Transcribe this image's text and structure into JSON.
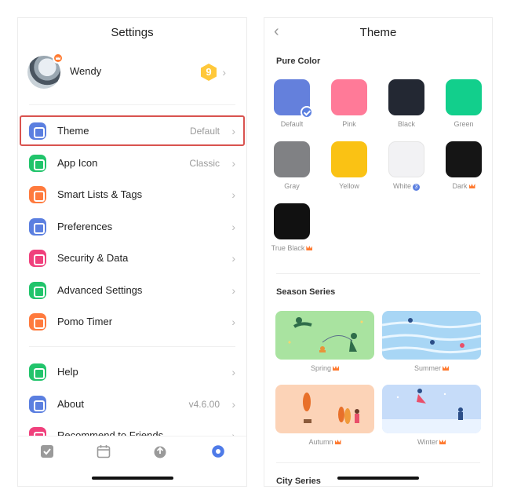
{
  "settings": {
    "title": "Settings",
    "profile": {
      "name": "Wendy",
      "level": "9"
    },
    "menu": [
      {
        "label": "Theme",
        "value": "Default",
        "icon": "theme-icon",
        "color": "#5b7fe0"
      },
      {
        "label": "App Icon",
        "value": "Classic",
        "icon": "app-icon-icon",
        "color": "#21c46b"
      },
      {
        "label": "Smart Lists & Tags",
        "value": "",
        "icon": "smart-lists-icon",
        "color": "#ff7a3d"
      },
      {
        "label": "Preferences",
        "value": "",
        "icon": "preferences-icon",
        "color": "#5b7fe0"
      },
      {
        "label": "Security & Data",
        "value": "",
        "icon": "lock-icon",
        "color": "#f0407c"
      },
      {
        "label": "Advanced Settings",
        "value": "",
        "icon": "sliders-icon",
        "color": "#21c46b"
      },
      {
        "label": "Pomo Timer",
        "value": "",
        "icon": "pomo-timer-icon",
        "color": "#ff7a3d"
      }
    ],
    "menu2": [
      {
        "label": "Help",
        "value": "",
        "icon": "help-icon",
        "color": "#21c46b"
      },
      {
        "label": "About",
        "value": "v4.6.00",
        "icon": "info-icon",
        "color": "#5b7fe0"
      },
      {
        "label": "Recommend to Friends",
        "value": "",
        "icon": "thumbs-up-icon",
        "color": "#f0407c"
      }
    ],
    "tabs": [
      "tasks-tab",
      "calendar-tab",
      "habit-tab",
      "settings-tab"
    ]
  },
  "theme": {
    "title": "Theme",
    "pure_color_header": "Pure Color",
    "pure_colors": [
      {
        "label": "Default",
        "color": "#6480dc",
        "selected": true,
        "mark": ""
      },
      {
        "label": "Pink",
        "color": "#ff7a98",
        "selected": false,
        "mark": ""
      },
      {
        "label": "Black",
        "color": "#232833",
        "selected": false,
        "mark": ""
      },
      {
        "label": "Green",
        "color": "#12cf8c",
        "selected": false,
        "mark": ""
      },
      {
        "label": "Gray",
        "color": "#808184",
        "selected": false,
        "mark": ""
      },
      {
        "label": "Yellow",
        "color": "#fac214",
        "selected": false,
        "mark": ""
      },
      {
        "label": "White",
        "color": "#f2f2f4",
        "selected": false,
        "mark": "badge",
        "badge_text": "3"
      },
      {
        "label": "Dark",
        "color": "#151515",
        "selected": false,
        "mark": "crown"
      },
      {
        "label": "True Black",
        "color": "#111111",
        "selected": false,
        "mark": "crown"
      }
    ],
    "season_header": "Season Series",
    "seasons": [
      {
        "label": "Spring",
        "bg": "#a9e3a0"
      },
      {
        "label": "Summer",
        "bg": "#a8d6f5"
      },
      {
        "label": "Autumn",
        "bg": "#fcd3b7"
      },
      {
        "label": "Winter",
        "bg": "#c6dcf9"
      }
    ],
    "city_header": "City Series"
  }
}
